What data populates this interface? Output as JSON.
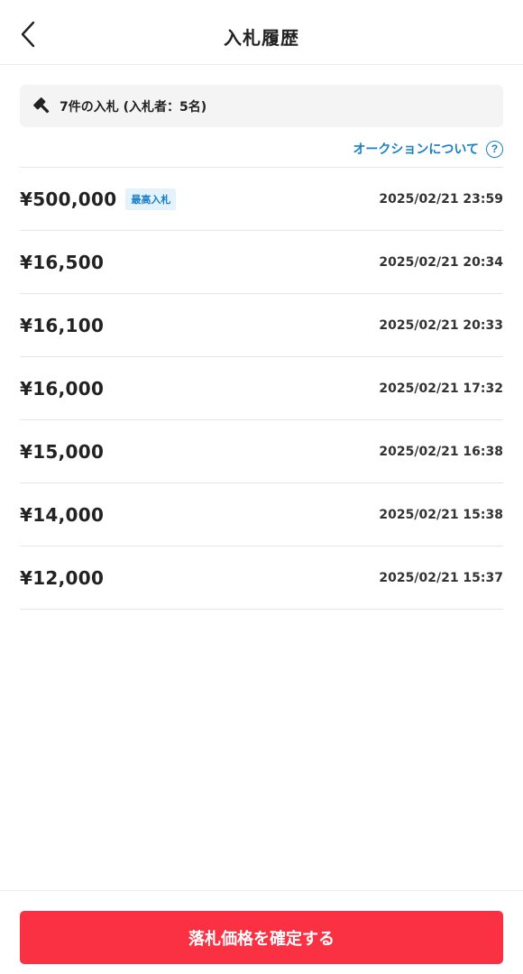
{
  "header": {
    "title": "入札履歴",
    "back_icon": "chevron-left-icon"
  },
  "summary": {
    "icon": "gavel-icon",
    "text": "7件の入札 (入札者：5名)"
  },
  "about": {
    "label": "オークションについて",
    "icon": "help-circle-icon",
    "icon_glyph": "?"
  },
  "bids": [
    {
      "price": "¥500,000",
      "badge": "最高入札",
      "time": "2025/02/21 23:59"
    },
    {
      "price": "¥16,500",
      "badge": "",
      "time": "2025/02/21 20:34"
    },
    {
      "price": "¥16,100",
      "badge": "",
      "time": "2025/02/21 20:33"
    },
    {
      "price": "¥16,000",
      "badge": "",
      "time": "2025/02/21 17:32"
    },
    {
      "price": "¥15,000",
      "badge": "",
      "time": "2025/02/21 16:38"
    },
    {
      "price": "¥14,000",
      "badge": "",
      "time": "2025/02/21 15:38"
    },
    {
      "price": "¥12,000",
      "badge": "",
      "time": "2025/02/21 15:37"
    }
  ],
  "footer": {
    "confirm_label": "落札価格を確定する"
  },
  "colors": {
    "accent": "#1a7fc4",
    "confirm": "#fa3043"
  }
}
